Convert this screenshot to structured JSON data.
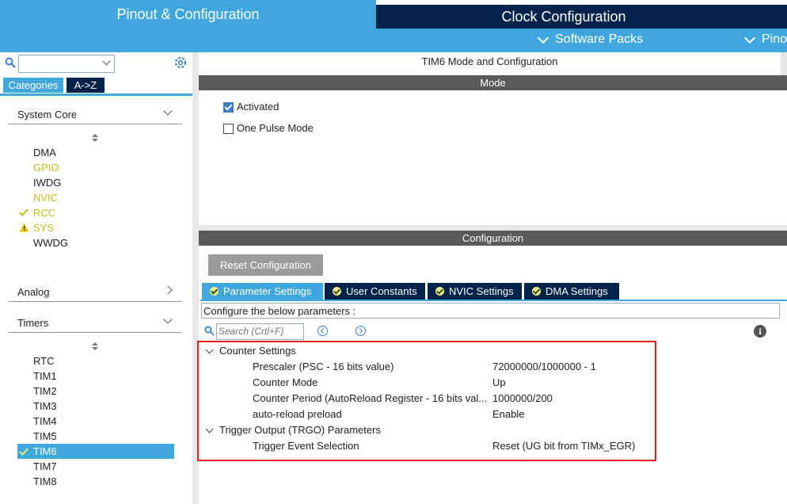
{
  "header": {
    "tabs": [
      {
        "label": "Pinout & Configuration",
        "active": true
      },
      {
        "label": "Clock Configuration",
        "active": false
      }
    ],
    "subnav": [
      {
        "label": "Software Packs"
      },
      {
        "label": "Pino"
      }
    ],
    "colors": {
      "light_blue": "#3fa7dd",
      "dark_navy": "#03234b"
    }
  },
  "sidebar": {
    "search": {
      "value": ""
    },
    "view_tabs": [
      {
        "label": "Categories",
        "active": true
      },
      {
        "label": "A->Z",
        "active": false
      }
    ],
    "groups": {
      "system_core": {
        "title": "System Core",
        "expanded": true,
        "items": [
          {
            "label": "DMA",
            "status": "none"
          },
          {
            "label": "GPIO",
            "status": "partial"
          },
          {
            "label": "IWDG",
            "status": "none"
          },
          {
            "label": "NVIC",
            "status": "partial"
          },
          {
            "label": "RCC",
            "status": "ok"
          },
          {
            "label": "SYS",
            "status": "warning"
          },
          {
            "label": "WWDG",
            "status": "none"
          }
        ]
      },
      "analog": {
        "title": "Analog",
        "expanded": false
      },
      "timers": {
        "title": "Timers",
        "expanded": true,
        "items": [
          {
            "label": "RTC",
            "status": "none"
          },
          {
            "label": "TIM1",
            "status": "none"
          },
          {
            "label": "TIM2",
            "status": "none"
          },
          {
            "label": "TIM3",
            "status": "none"
          },
          {
            "label": "TIM4",
            "status": "none"
          },
          {
            "label": "TIM5",
            "status": "none"
          },
          {
            "label": "TIM6",
            "status": "ok",
            "selected": true
          },
          {
            "label": "TIM7",
            "status": "none"
          },
          {
            "label": "TIM8",
            "status": "none"
          }
        ]
      }
    }
  },
  "main": {
    "title": "TIM6 Mode and Configuration",
    "mode": {
      "header": "Mode",
      "options": [
        {
          "label": "Activated",
          "checked": true
        },
        {
          "label": "One Pulse Mode",
          "checked": false
        }
      ]
    },
    "configuration": {
      "header": "Configuration",
      "reset_label": "Reset Configuration",
      "tabs": [
        {
          "label": "Parameter Settings",
          "active": true
        },
        {
          "label": "User Constants",
          "active": false
        },
        {
          "label": "NVIC Settings",
          "active": false
        },
        {
          "label": "DMA Settings",
          "active": false
        }
      ],
      "description": "Configure the below parameters :",
      "search_placeholder": "Search (Crtl+F)",
      "sections": [
        {
          "title": "Counter Settings",
          "params": [
            {
              "name": "Prescaler (PSC - 16 bits value)",
              "value": "72000000/1000000 - 1"
            },
            {
              "name": "Counter Mode",
              "value": "Up"
            },
            {
              "name": "Counter Period (AutoReload Register - 16 bits val...",
              "value": "1000000/200"
            },
            {
              "name": "auto-reload preload",
              "value": "Enable"
            }
          ]
        },
        {
          "title": "Trigger Output (TRGO) Parameters",
          "params": [
            {
              "name": "Trigger Event Selection",
              "value": "Reset (UG bit from TIMx_EGR)"
            }
          ]
        }
      ]
    }
  }
}
